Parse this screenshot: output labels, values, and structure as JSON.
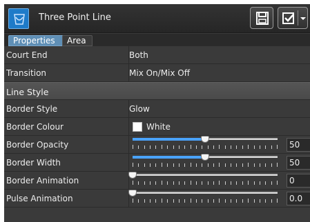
{
  "window": {
    "title": "Three Point Line"
  },
  "header": {
    "app_icon": "basketball-court-icon",
    "save_icon": "save-icon",
    "apply_icon": "checkbox-check-icon",
    "menu_icon": "chevron-down-icon"
  },
  "tabs": [
    {
      "label": "Properties",
      "active": true
    },
    {
      "label": "Area",
      "active": false
    }
  ],
  "properties": {
    "court_end": {
      "label": "Court End",
      "value": "Both"
    },
    "transition": {
      "label": "Transition",
      "value": "Mix On/Mix Off"
    },
    "section_label": "Line Style",
    "border_style": {
      "label": "Border Style",
      "value": "Glow"
    },
    "border_colour": {
      "label": "Border Colour",
      "value": "White",
      "swatch": "#ffffff"
    },
    "border_opacity": {
      "label": "Border Opacity",
      "value": "50",
      "fraction": 0.5
    },
    "border_width": {
      "label": "Border Width",
      "value": "50",
      "fraction": 0.5
    },
    "border_animation": {
      "label": "Border Animation",
      "value": "0",
      "fraction": 0.0
    },
    "pulse_animation": {
      "label": "Pulse Animation",
      "value": "0.0",
      "fraction": 0.0
    }
  },
  "colors": {
    "accent": "#4aa3ff",
    "tab_active": "#5f8fb6",
    "panel": "#3a3a3a"
  }
}
